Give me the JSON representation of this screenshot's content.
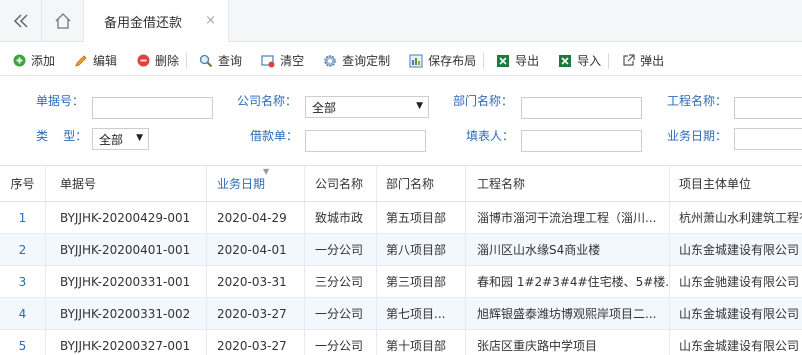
{
  "tabbar": {
    "back_icon": "double-chevron-left-icon",
    "home_icon": "home-icon",
    "active_tab": "备用金借还款",
    "close_glyph": "×"
  },
  "toolbar": {
    "items": [
      {
        "label": "添加",
        "icon": "add-icon"
      },
      {
        "label": "编辑",
        "icon": "edit-icon"
      },
      {
        "label": "删除",
        "icon": "delete-icon"
      },
      {
        "label": "查询",
        "icon": "search-icon"
      },
      {
        "label": "清空",
        "icon": "clear-icon"
      },
      {
        "label": "查询定制",
        "icon": "gear-icon"
      },
      {
        "label": "保存布局",
        "icon": "save-layout-icon"
      },
      {
        "label": "导出",
        "icon": "excel-export-icon"
      },
      {
        "label": "导入",
        "icon": "excel-import-icon"
      },
      {
        "label": "弹出",
        "icon": "popout-icon"
      }
    ]
  },
  "form": {
    "doc_no_label": "单据号：",
    "company_label": "公司名称：",
    "company_value": "全部",
    "dept_label": "部门名称：",
    "project_label": "工程名称：",
    "type_label": "类    型：",
    "type_value": "全部",
    "loan_label": "借款单：",
    "filler_label": "填表人：",
    "date_label": "业务日期："
  },
  "grid": {
    "columns": [
      "序号",
      "单据号",
      "业务日期",
      "公司名称",
      "部门名称",
      "工程名称",
      "项目主体单位"
    ],
    "rows": [
      {
        "no": "1",
        "doc": "BYJJHK-20200429-001",
        "date": "2020-04-29",
        "company": "致城市政",
        "dept": "第五项目部",
        "project": "淄博市淄河干流治理工程（淄川...",
        "unit": "杭州萧山水利建筑工程有"
      },
      {
        "no": "2",
        "doc": "BYJJHK-20200401-001",
        "date": "2020-04-01",
        "company": "一分公司",
        "dept": "第八项目部",
        "project": "淄川区山水缘S4商业楼",
        "unit": "山东金城建设有限公司"
      },
      {
        "no": "3",
        "doc": "BYJJHK-20200331-001",
        "date": "2020-03-31",
        "company": "三分公司",
        "dept": "第三项目部",
        "project": "春和园 1#2#3#4#住宅楼、5#楼...",
        "unit": "山东金驰建设有限公司"
      },
      {
        "no": "4",
        "doc": "BYJJHK-20200331-002",
        "date": "2020-03-27",
        "company": "一分公司",
        "dept": "第七项目...",
        "project": "旭辉银盛泰潍坊博观熙岸项目二...",
        "unit": "山东金城建设有限公司"
      },
      {
        "no": "5",
        "doc": "BYJJHK-20200327-001",
        "date": "2020-03-27",
        "company": "一分公司",
        "dept": "第十项目部",
        "project": "张店区重庆路中学项目",
        "unit": "山东金城建设有限公司"
      }
    ]
  }
}
